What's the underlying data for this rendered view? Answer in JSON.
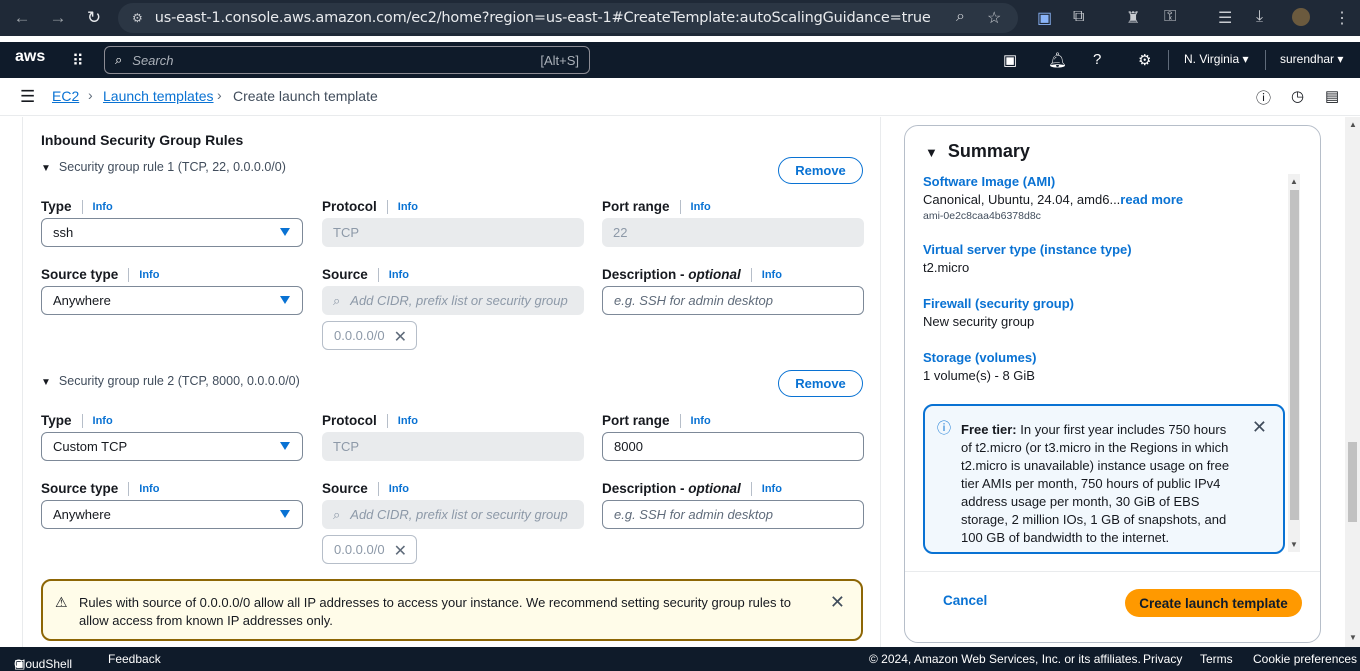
{
  "browser": {
    "url": "us-east-1.console.aws.amazon.com/ec2/home?region=us-east-1#CreateTemplate:autoScalingGuidance=true",
    "back_icon": "arrow-left-icon",
    "forward_icon": "arrow-right-icon",
    "reload_icon": "reload-icon"
  },
  "topnav": {
    "logo": "aws",
    "search_placeholder": "Search",
    "search_shortcut": "[Alt+S]",
    "region": "N. Virginia",
    "user": "surendhar"
  },
  "breadcrumb": {
    "items": [
      "EC2",
      "Launch templates"
    ],
    "current": "Create launch template"
  },
  "form": {
    "section_title": "Inbound Security Group Rules",
    "info_label": "Info",
    "remove_label": "Remove",
    "labels": {
      "type": "Type",
      "protocol": "Protocol",
      "port_range": "Port range",
      "source_type": "Source type",
      "source": "Source",
      "description": "Description",
      "optional": "optional",
      "description_sep": " - "
    },
    "rules": [
      {
        "title": "Security group rule 1 (TCP, 22, 0.0.0.0/0)",
        "type": "ssh",
        "protocol": "TCP",
        "port_range": "22",
        "source_type": "Anywhere",
        "source_placeholder": "Add CIDR, prefix list or security group",
        "source_token": "0.0.0.0/0",
        "description_placeholder": "e.g. SSH for admin desktop"
      },
      {
        "title": "Security group rule 2 (TCP, 8000, 0.0.0.0/0)",
        "type": "Custom TCP",
        "protocol": "TCP",
        "port_range": "8000",
        "source_type": "Anywhere",
        "source_placeholder": "Add CIDR, prefix list or security group",
        "source_token": "0.0.0.0/0",
        "description_placeholder": "e.g. SSH for admin desktop"
      }
    ],
    "warning": "Rules with source of 0.0.0.0/0 allow all IP addresses to access your instance. We recommend setting security group rules to allow access from known IP addresses only."
  },
  "summary": {
    "title": "Summary",
    "ami_key": "Software Image (AMI)",
    "ami_value": "Canonical, Ubuntu, 24.04, amd6...",
    "ami_read_more": "read more",
    "ami_id": "ami-0e2c8caa4b6378d8c",
    "instance_key": "Virtual server type (instance type)",
    "instance_value": "t2.micro",
    "firewall_key": "Firewall (security group)",
    "firewall_value": "New security group",
    "storage_key": "Storage (volumes)",
    "storage_value": "1 volume(s) - 8 GiB",
    "free_tier_title": "Free tier:",
    "free_tier_text": "In your first year includes 750 hours of t2.micro (or t3.micro in the Regions in which t2.micro is unavailable) instance usage on free tier AMIs per month, 750 hours of public IPv4 address usage per month, 30 GiB of EBS storage, 2 million IOs, 1 GB of snapshots, and 100 GB of bandwidth to the internet.",
    "cancel": "Cancel",
    "create": "Create launch template"
  },
  "footer": {
    "cloudshell": "CloudShell",
    "feedback": "Feedback",
    "copyright": "© 2024, Amazon Web Services, Inc. or its affiliates.",
    "privacy": "Privacy",
    "terms": "Terms",
    "cookies": "Cookie preferences"
  },
  "colors": {
    "link": "#0972d3",
    "primary_button": "#ff9900",
    "nav_bg": "#0f1b2a",
    "warning_border": "#8d6605"
  }
}
